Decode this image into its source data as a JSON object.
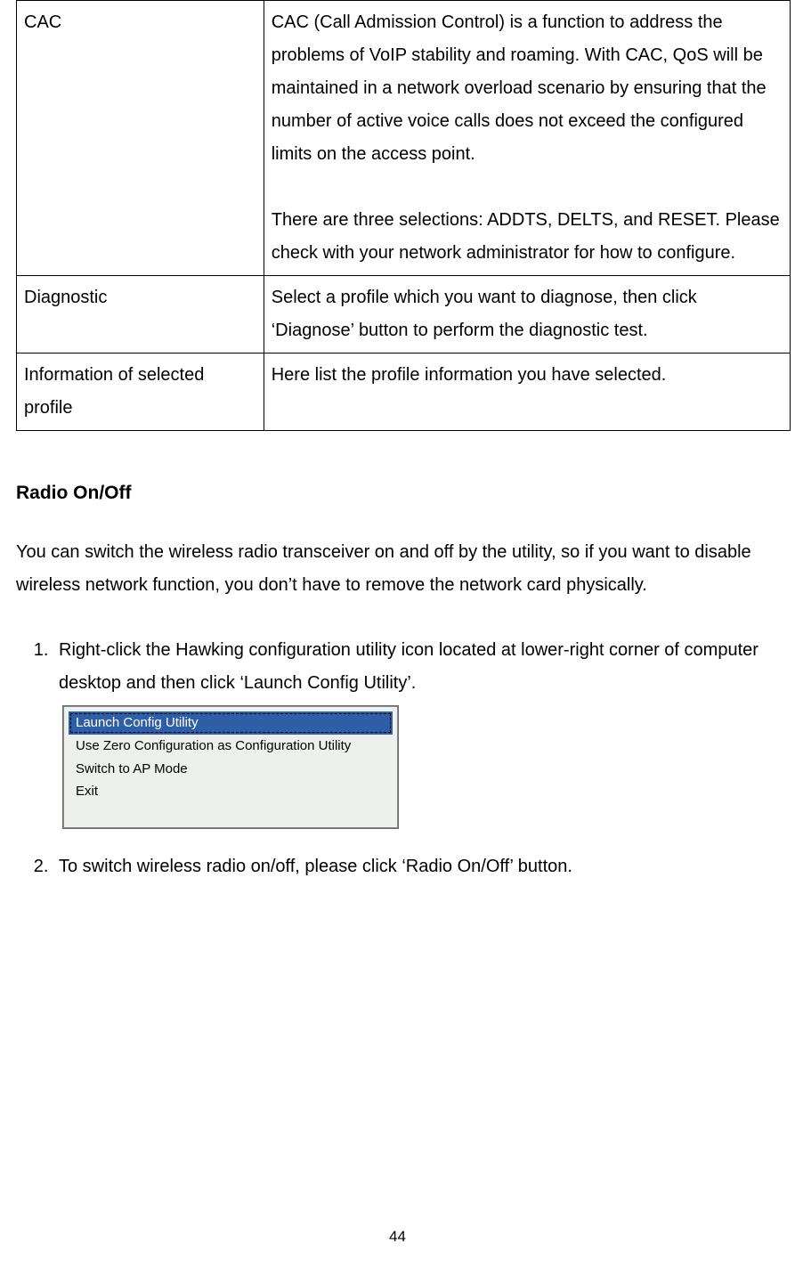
{
  "table": {
    "rows": [
      {
        "term": "CAC",
        "desc_p1": "CAC (Call Admission Control) is a function to address the problems of VoIP stability and roaming. With CAC, QoS will be maintained in a network overload scenario by ensuring that the number of active voice calls does not exceed the configured limits on the access point.",
        "desc_p2": "There are three selections: ADDTS, DELTS, and RESET. Please check with your network administrator for how to configure."
      },
      {
        "term": "Diagnostic",
        "desc_p1": "Select a profile which you want to diagnose, then click ‘Diagnose’ button to perform the diagnostic test."
      },
      {
        "term": "Information of selected profile",
        "desc_p1": "Here list the profile information you have selected."
      }
    ]
  },
  "section_heading": "Radio On/Off",
  "intro": "You can switch the wireless radio transceiver on and off by the utility, so if you want to disable wireless network function, you don’t have to remove the network card physically.",
  "steps": [
    "Right-click the Hawking configuration utility icon located at lower-right corner of computer desktop and then click ‘Launch Config Utility’.",
    "To switch wireless radio on/off, please click ‘Radio On/Off’ button."
  ],
  "context_menu": {
    "items": [
      {
        "label": "Launch Config Utility",
        "selected": true
      },
      {
        "label": "Use Zero Configuration as Configuration Utility",
        "selected": false
      },
      {
        "label": "Switch to AP Mode",
        "selected": false
      },
      {
        "label": "Exit",
        "selected": false
      }
    ]
  },
  "page_number": "44"
}
